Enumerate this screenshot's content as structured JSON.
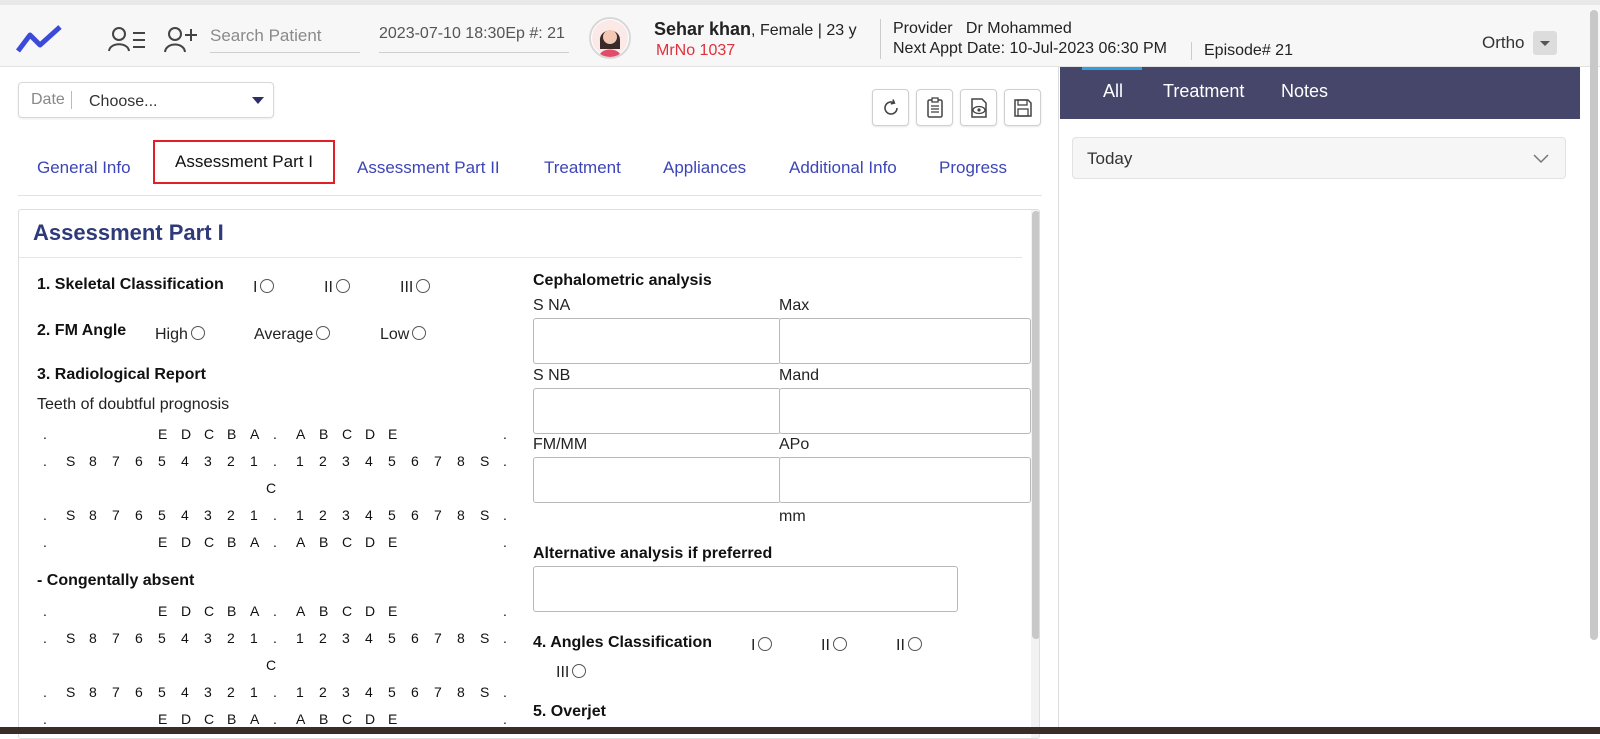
{
  "header": {
    "search_placeholder": "Search Patient",
    "datetime": "2023-07-10 18:30Ep #: 21",
    "patient_name": "Sehar khan",
    "patient_meta": ", Female | 23 y",
    "mrno": "MrNo 1037",
    "provider_label": "Provider",
    "provider_name": "Dr Mohammed",
    "next_appt_label": "Next Appt Date",
    "next_appt_value": ": 10-Jul-2023 06:30 PM",
    "episode": "Episode# 21",
    "specialty": "Ortho"
  },
  "date_filter": {
    "label": "Date",
    "value": "Choose..."
  },
  "tabs": [
    {
      "label": "General Info"
    },
    {
      "label": "Assessment Part I"
    },
    {
      "label": "Assessment Part II"
    },
    {
      "label": "Treatment"
    },
    {
      "label": "Appliances"
    },
    {
      "label": "Additional Info"
    },
    {
      "label": "Progress"
    }
  ],
  "section": {
    "title": "Assessment Part I",
    "skeletal": {
      "label": "1. Skeletal Classification",
      "options": [
        "I",
        "II",
        "III"
      ]
    },
    "fm_angle": {
      "label": "2. FM Angle",
      "options": [
        "High",
        "Average",
        "Low"
      ]
    },
    "radiological": {
      "label": "3. Radiological Report",
      "sub": "Teeth of doubtful prognosis"
    },
    "congenital": {
      "label": "- Congentally absent"
    },
    "ceph": {
      "label": "Cephalometric analysis",
      "fields": [
        {
          "left": "S NA",
          "right": "Max"
        },
        {
          "left": "S NB",
          "right": "Mand"
        },
        {
          "left": "FM/MM",
          "right": "APo"
        }
      ],
      "unit": "mm"
    },
    "alt": {
      "label": "Alternative analysis if preferred"
    },
    "angles": {
      "label": "4. Angles Classification",
      "options": [
        "I",
        "II",
        "II",
        "III"
      ]
    },
    "overjet": {
      "label": "5. Overjet"
    }
  },
  "dental_chart": {
    "row_primary_top": [
      ".",
      "",
      "",
      "",
      "",
      "E",
      "D",
      "C",
      "B",
      "A",
      ".",
      "A",
      "B",
      "C",
      "D",
      "E",
      "",
      "",
      "",
      "",
      "."
    ],
    "row_perm_top": [
      ".",
      "S",
      "8",
      "7",
      "6",
      "5",
      "4",
      "3",
      "2",
      "1",
      ".",
      "1",
      "2",
      "3",
      "4",
      "5",
      "6",
      "7",
      "8",
      "S",
      "."
    ],
    "center": "C",
    "row_perm_bottom": [
      ".",
      "S",
      "8",
      "7",
      "6",
      "5",
      "4",
      "3",
      "2",
      "1",
      ".",
      "1",
      "2",
      "3",
      "4",
      "5",
      "6",
      "7",
      "8",
      "S",
      "."
    ],
    "row_primary_bottom": [
      ".",
      "",
      "",
      "",
      "",
      "E",
      "D",
      "C",
      "B",
      "A",
      ".",
      "A",
      "B",
      "C",
      "D",
      "E",
      "",
      "",
      "",
      "",
      "."
    ]
  },
  "right_panel": {
    "tabs": [
      "All",
      "Treatment",
      "Notes"
    ],
    "group": "Today"
  }
}
